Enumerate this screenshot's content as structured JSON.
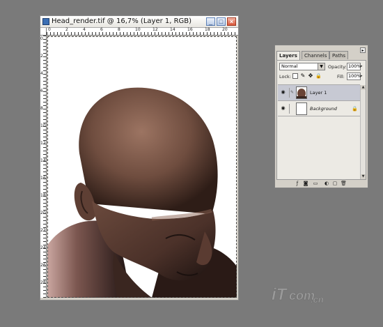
{
  "document": {
    "title": "Head_render.tif @ 16,7% (Layer 1, RGB)",
    "ruler_numbers_top": [
      "0",
      "2",
      "4",
      "6",
      "8",
      "10",
      "12",
      "14",
      "16",
      "18",
      "20"
    ],
    "ruler_numbers_left": [
      "0",
      "2",
      "4",
      "6",
      "8",
      "10",
      "12",
      "14",
      "16",
      "18",
      "20",
      "22",
      "24",
      "26",
      "28"
    ]
  },
  "layers_palette": {
    "tabs": [
      "Layers",
      "Channels",
      "Paths"
    ],
    "active_tab": "Layers",
    "blend_mode": "Normal",
    "opacity_label": "Opacity:",
    "opacity_value": "100%",
    "lock_label": "Lock:",
    "fill_label": "Fill:",
    "fill_value": "100%",
    "layers": [
      {
        "name": "Layer 1",
        "selected": true,
        "visible": true
      },
      {
        "name": "Background",
        "selected": false,
        "visible": true,
        "locked": true
      }
    ]
  },
  "watermark": {
    "text_main": "iT",
    "text_mid": "com",
    "text_tail": ".cn"
  },
  "colors": {
    "workspace": "#7a7a7a",
    "selection": "#c7c9d3",
    "skin": "#7a5646"
  }
}
